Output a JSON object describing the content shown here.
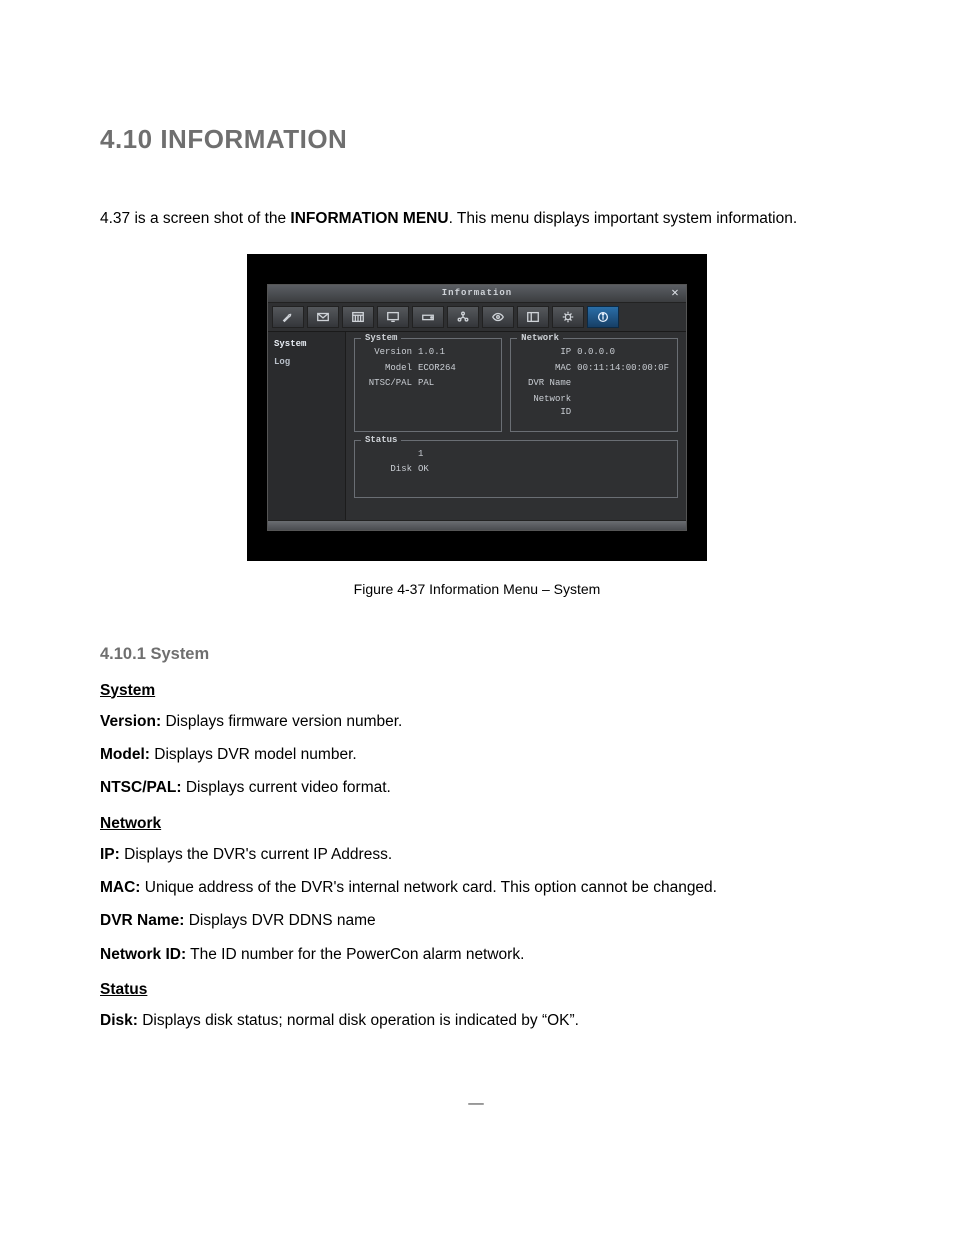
{
  "heading": "4.10 INFORMATION",
  "intro_prefix": "4.37 is a screen shot of the ",
  "intro_bold": "INFORMATION MENU",
  "intro_suffix": ". This menu displays important system information.",
  "screenshot": {
    "title": "Information",
    "close": "✕",
    "sidebar": {
      "items": [
        {
          "label": "System",
          "active": true
        },
        {
          "label": "Log",
          "active": false
        }
      ]
    },
    "system_box": {
      "legend": "System",
      "rows": [
        {
          "k": "Version",
          "v": "1.0.1"
        },
        {
          "k": "Model",
          "v": "ECOR264"
        },
        {
          "k": "NTSC/PAL",
          "v": "PAL"
        }
      ]
    },
    "network_box": {
      "legend": "Network",
      "rows": [
        {
          "k": "IP",
          "v": "0.0.0.0"
        },
        {
          "k": "MAC",
          "v": "00:11:14:00:00:0F"
        },
        {
          "k": "DVR Name",
          "v": ""
        },
        {
          "k": "Network ID",
          "v": ""
        }
      ]
    },
    "status_box": {
      "legend": "Status",
      "rows": [
        {
          "k": "",
          "v": "1"
        },
        {
          "k": "Disk",
          "v": "OK"
        }
      ]
    },
    "toolbar_icons": [
      "wrench-icon",
      "envelope-icon",
      "calendar-icon",
      "monitor-icon",
      "drive-icon",
      "network-icon",
      "eye-icon",
      "layout-icon",
      "gear-icon",
      "info-icon"
    ]
  },
  "figure_caption": "Figure 4-37 Information Menu – System",
  "subsection": "4.10.1 System",
  "groups": [
    {
      "title": "System",
      "lines": [
        {
          "label": "Version:",
          "text": " Displays firmware version number."
        },
        {
          "label": "Model:",
          "text": " Displays DVR model number."
        },
        {
          "label": "NTSC/PAL:",
          "text": " Displays current video format."
        }
      ]
    },
    {
      "title": "Network",
      "lines": [
        {
          "label": "IP:",
          "text": " Displays the DVR's current IP Address."
        },
        {
          "label": "MAC:",
          "text": " Unique address of the DVR's internal network card. This option cannot be changed."
        },
        {
          "label": "DVR Name:",
          "text": " Displays DVR DDNS name"
        },
        {
          "label": "Network ID:",
          "text": " The ID number for the PowerCon alarm network."
        }
      ]
    },
    {
      "title": "Status",
      "lines": [
        {
          "label": "Disk:",
          "text": " Displays disk status; normal disk operation is indicated by “OK”."
        }
      ]
    }
  ],
  "page_marker": "—"
}
